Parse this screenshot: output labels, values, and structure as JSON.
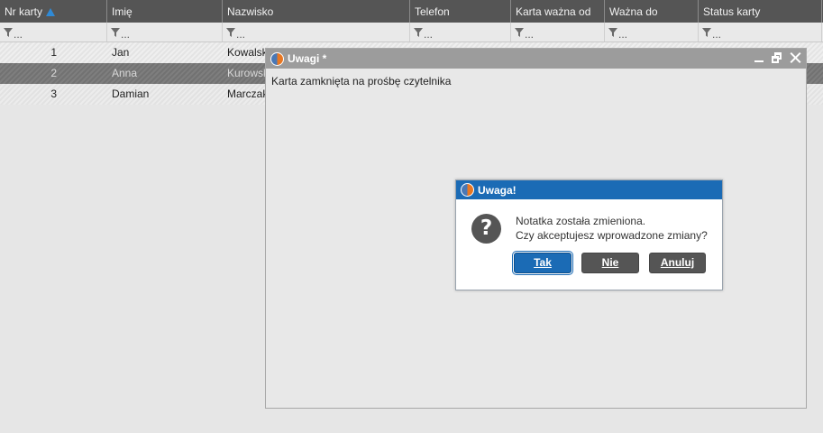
{
  "grid": {
    "columns": [
      {
        "label": "Nr karty",
        "sorted": "ascending"
      },
      {
        "label": "Imię"
      },
      {
        "label": "Nazwisko"
      },
      {
        "label": "Telefon"
      },
      {
        "label": "Karta ważna od"
      },
      {
        "label": "Ważna do"
      },
      {
        "label": "Status karty"
      }
    ],
    "filter_placeholder": "...",
    "rows": [
      {
        "nr": "1",
        "imie": "Jan",
        "nazwisko": "Kowalski"
      },
      {
        "nr": "2",
        "imie": "Anna",
        "nazwisko": "Kurowska"
      },
      {
        "nr": "3",
        "imie": "Damian",
        "nazwisko": "Marczak"
      }
    ]
  },
  "notes_window": {
    "title": "Uwagi *",
    "content": "Karta zamknięta na prośbę czytelnika"
  },
  "dialog": {
    "title": "Uwaga!",
    "icon": "question-icon",
    "message_line1": "Notatka została zmieniona.",
    "message_line2": "Czy akceptujesz wprowadzone zmiany?",
    "buttons": {
      "yes": "Tak",
      "no": "Nie",
      "cancel": "Anuluj"
    }
  },
  "colors": {
    "header_bg": "#555555",
    "sort_accent": "#2f8ad6",
    "dialog_title_bg": "#1b6bb5",
    "notes_title_bg": "#9c9c9c"
  }
}
